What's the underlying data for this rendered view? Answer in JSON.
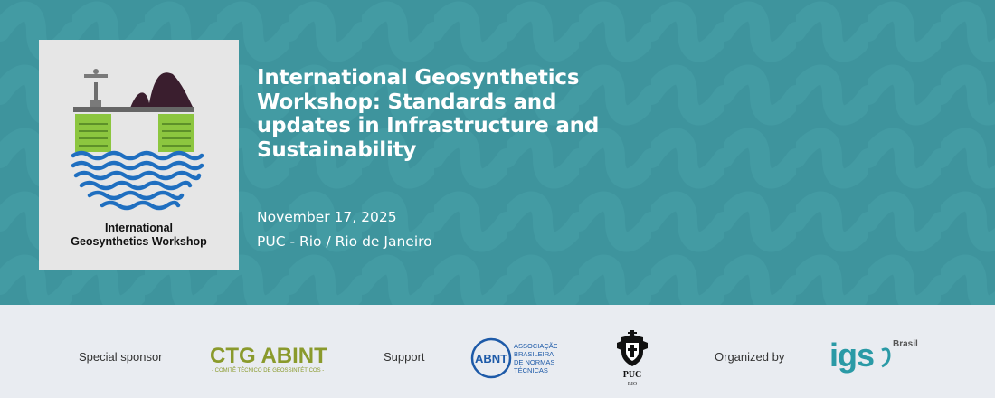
{
  "event": {
    "title": "International Geosynthetics Workshop: Standards and updates in Infrastructure and Sustainability",
    "date": "November 17, 2025",
    "location": "PUC - Rio / Rio de Janeiro"
  },
  "logo": {
    "caption_line1": "International",
    "caption_line2": "Geosynthetics Workshop"
  },
  "footer": {
    "special_sponsor_label": "Special sponsor",
    "support_label": "Support",
    "organized_by_label": "Organized by",
    "ctg_abint": {
      "wordmark": "CTG ABINT",
      "tagline": "- COMITÊ TÉCNICO DE GEOSSINTÉTICOS -"
    },
    "abnt": {
      "monogram": "ABNT",
      "line1": "ASSOCIAÇÃO",
      "line2": "BRASILEIRA",
      "line3": "DE NORMAS",
      "line4": "TÉCNICAS"
    },
    "puc": {
      "line1": "PUC",
      "line2": "RIO"
    },
    "igs": {
      "wordmark": "igs",
      "suffix": "Brasil"
    }
  },
  "colors": {
    "hero_background": "#3e949d",
    "footer_background": "#e9ecf1",
    "logo_green": "#8cc63f",
    "logo_blue": "#1f6fc0",
    "ctg_olive": "#8a9a2c",
    "abint_green": "#2f7a3c",
    "abnt_blue": "#1d5aa8",
    "igs_teal": "#2a9aa6"
  }
}
